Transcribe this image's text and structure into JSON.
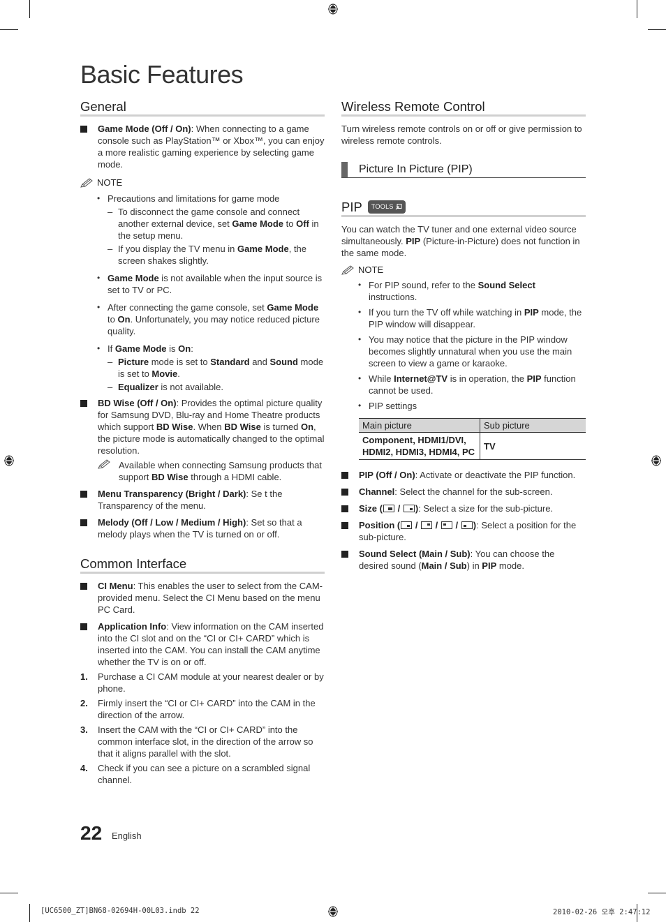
{
  "page": {
    "title": "Basic Features",
    "page_number": "22",
    "language": "English",
    "slug_file": "[UC6500_ZT]BN68-02694H-00L03.indb   22",
    "slug_date": "2010-02-26   오후 2:47:12"
  },
  "general": {
    "heading": "General",
    "game_mode": {
      "label": "Game Mode (Off / On)",
      "text": ": When connecting to a game console such as PlayStation™ or Xbox™, you can enjoy a more realistic gaming experience by selecting game mode."
    },
    "note_label": "NOTE",
    "notes": {
      "precautions": "Precautions and limitations for game mode",
      "dash1_a": "To disconnect the game console and connect another external device, set ",
      "dash1_b": "Game Mode",
      "dash1_c": " to ",
      "dash1_d": "Off",
      "dash1_e": " in the setup menu.",
      "dash2_a": "If you display the TV menu in ",
      "dash2_b": "Game Mode",
      "dash2_c": ", the screen shakes slightly.",
      "b2_a": "Game Mode",
      "b2_b": " is not available when the input source is set to TV or PC.",
      "b3_a": "After connecting the game console, set ",
      "b3_b": "Game Mode",
      "b3_c": " to ",
      "b3_d": "On",
      "b3_e": ". Unfortunately, you may notice reduced picture quality.",
      "b4_a": "If ",
      "b4_b": "Game Mode",
      "b4_c": " is ",
      "b4_d": "On",
      "b4_e": ":",
      "d3_a": "Picture",
      "d3_b": " mode is set to ",
      "d3_c": "Standard",
      "d3_d": " and ",
      "d3_e": "Sound",
      "d3_f": " mode is set to ",
      "d3_g": "Movie",
      "d3_h": ".",
      "d4_a": "Equalizer",
      "d4_b": " is not available."
    },
    "bd_wise": {
      "label": "BD Wise (Off / On)",
      "t1": ": Provides the optimal picture quality for Samsung DVD, Blu-ray and Home Theatre products which support ",
      "t2": "BD Wise",
      "t3": ". When ",
      "t4": "BD Wise",
      "t5": " is turned ",
      "t6": "On",
      "t7": ", the picture mode is automatically changed to the optimal resolution.",
      "note_a": "Available when connecting Samsung products that support ",
      "note_b": "BD Wise",
      "note_c": " through a HDMI cable."
    },
    "menu_transparency": {
      "label": "Menu Transparency (Bright / Dark)",
      "text": ": Se t the Transparency of the menu."
    },
    "melody": {
      "label": "Melody (Off / Low / Medium / High)",
      "text": ": Set so that a melody plays when the TV is turned on or off."
    }
  },
  "common_interface": {
    "heading": "Common Interface",
    "ci_menu": {
      "label": "CI Menu",
      "text": ": This enables the user to select from the CAM-provided menu. Select the CI Menu based on the menu PC Card."
    },
    "app_info": {
      "label": "Application Info",
      "text": ": View information on the CAM inserted into the CI slot and on the “CI or CI+ CARD” which is inserted into the CAM. You can install the CAM anytime whether the TV is on or off."
    },
    "steps": [
      {
        "num": "1.",
        "text": "Purchase a CI CAM module at your nearest dealer or by phone."
      },
      {
        "num": "2.",
        "text": "Firmly insert the “CI or CI+ CARD” into the CAM in the direction of the arrow."
      },
      {
        "num": "3.",
        "text": "Insert the CAM with the “CI or CI+ CARD” into the common interface slot, in the direction of the arrow so that it aligns parallel with the slot."
      },
      {
        "num": "4.",
        "text": "Check if you can see a picture on a scrambled signal channel."
      }
    ]
  },
  "wireless": {
    "heading": "Wireless Remote Control",
    "text": "Turn wireless remote controls on or off or give permission to wireless remote controls."
  },
  "pip_section": {
    "heading": "Picture In Picture (PIP)"
  },
  "pip": {
    "heading": "PIP",
    "tools_badge": "TOOLS",
    "intro_a": "You can watch the TV tuner and one external video source simultaneously. ",
    "intro_b": "PIP",
    "intro_c": " (Picture-in-Picture) does not function in the same mode.",
    "note_label": "NOTE",
    "n1_a": "For PIP sound, refer to the ",
    "n1_b": "Sound Select",
    "n1_c": " instructions.",
    "n2_a": "If you turn the TV off while watching in ",
    "n2_b": "PIP",
    "n2_c": " mode, the PIP window will disappear.",
    "n3": "You may notice that the picture in the PIP window becomes slightly unnatural when you use the main screen to view a game or karaoke.",
    "n4_a": "While ",
    "n4_b": "Internet@TV",
    "n4_c": " is in operation, the ",
    "n4_d": "PIP",
    "n4_e": " function cannot be used.",
    "n5": "PIP settings",
    "table": {
      "headers": [
        "Main picture",
        "Sub picture"
      ],
      "rows": [
        [
          "Component, HDMI1/DVI, HDMI2, HDMI3, HDMI4, PC",
          "TV"
        ]
      ]
    },
    "pip_onoff": {
      "label": "PIP (Off / On)",
      "text": ": Activate or deactivate the PIP function."
    },
    "channel": {
      "label": "Channel",
      "text": ": Select the channel for the sub-screen."
    },
    "size": {
      "label": "Size (",
      "sep": " / ",
      "close": ")",
      "text": ": Select a size for the sub-picture."
    },
    "position": {
      "label": "Position (",
      "sep": " / ",
      "close": ")",
      "text": ": Select a position for the sub-picture."
    },
    "sound_select": {
      "label": "Sound Select (Main / Sub)",
      "t1": ": You can choose the desired sound (",
      "t2": "Main / Sub",
      "t3": ") in ",
      "t4": "PIP",
      "t5": " mode."
    }
  }
}
